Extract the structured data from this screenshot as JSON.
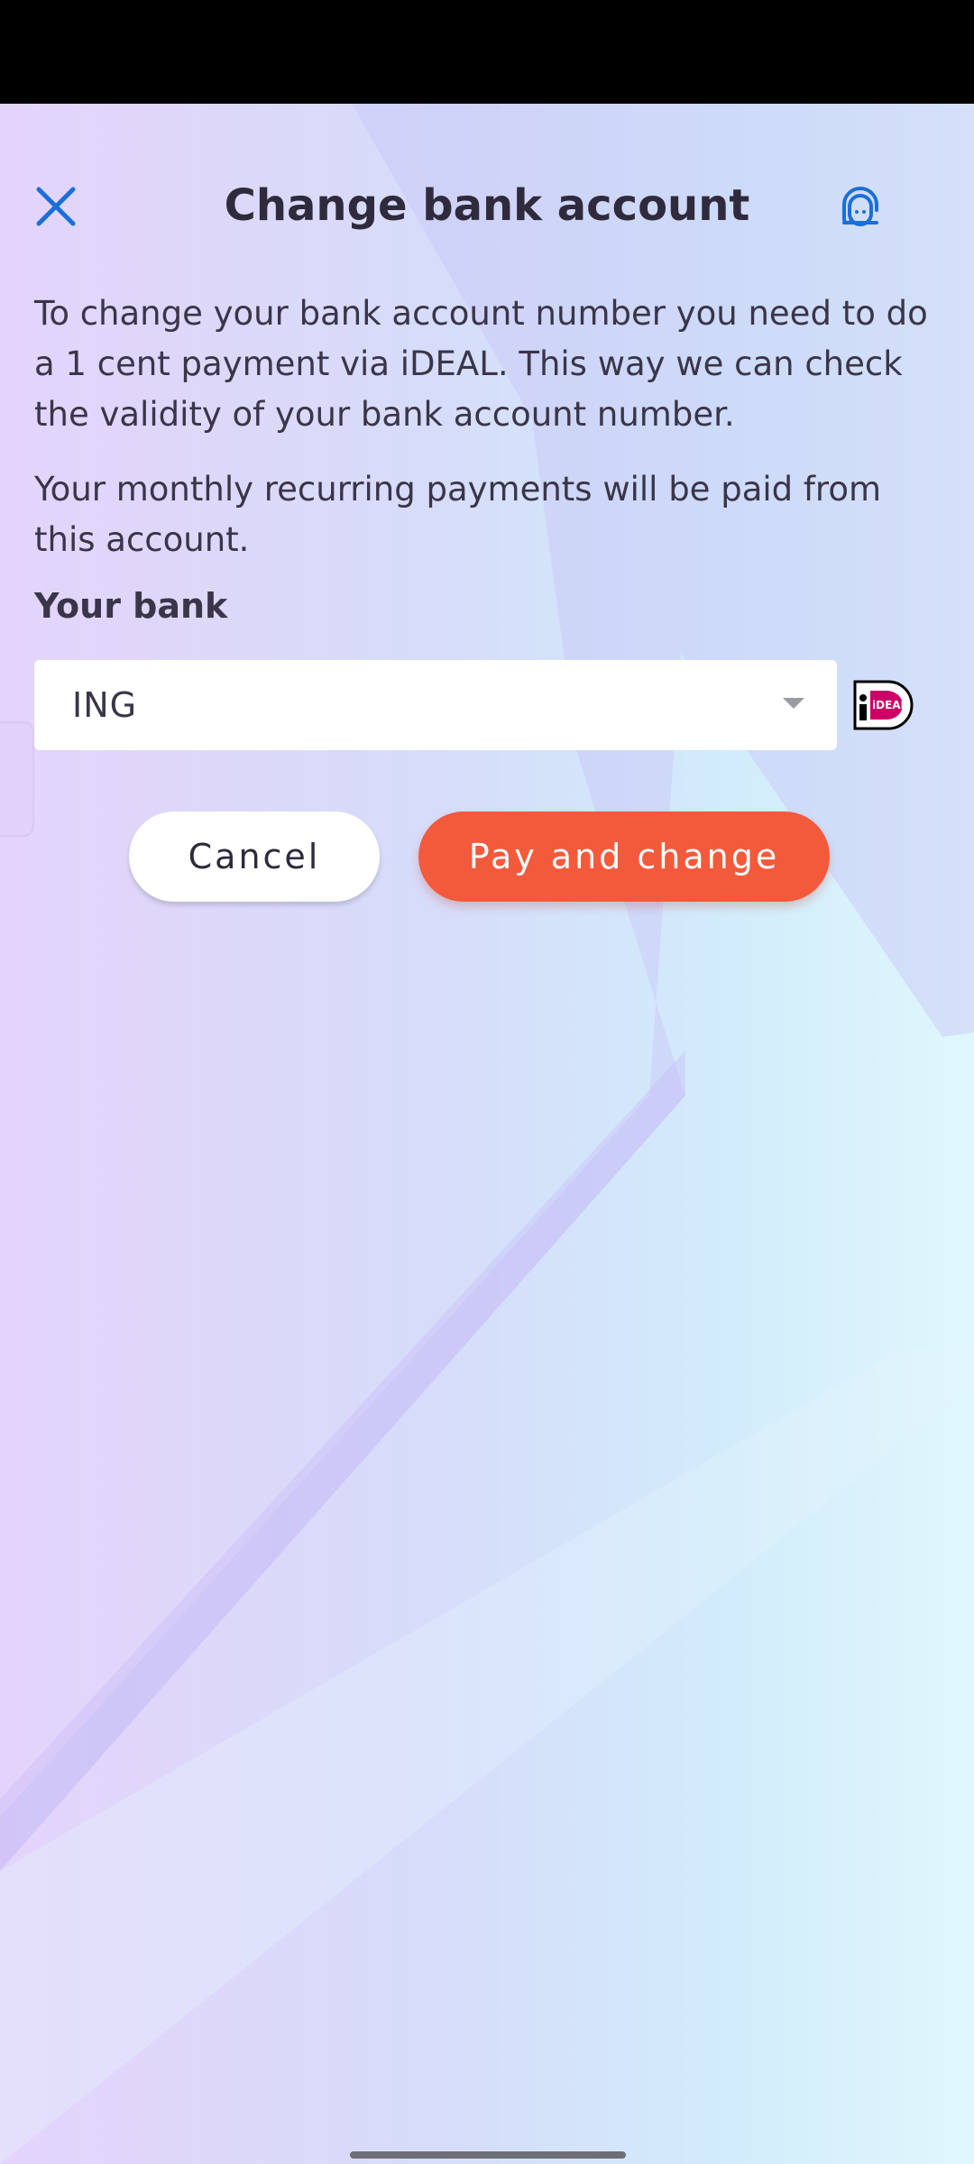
{
  "header": {
    "title": "Change bank account",
    "close_icon": "close-icon",
    "support_icon": "headset-icon"
  },
  "content": {
    "paragraph_1": "To change your bank account number you need to do a 1 cent payment via iDEAL. This way we can check the validity of your bank account number.",
    "paragraph_2": "Your monthly recurring payments will be paid from this account.",
    "bank_label": "Your bank",
    "bank_select": {
      "selected_value": "ING",
      "icon": "chevron-down-icon"
    },
    "payment_logo": "ideal-logo",
    "payment_logo_text": "iDEAL"
  },
  "actions": {
    "cancel_label": "Cancel",
    "pay_label": "Pay and change"
  },
  "colors": {
    "accent_blue": "#1b6fd8",
    "primary_button": "#f25a3b",
    "title_text": "#2f2a3c",
    "ideal_pink": "#cc0066"
  }
}
